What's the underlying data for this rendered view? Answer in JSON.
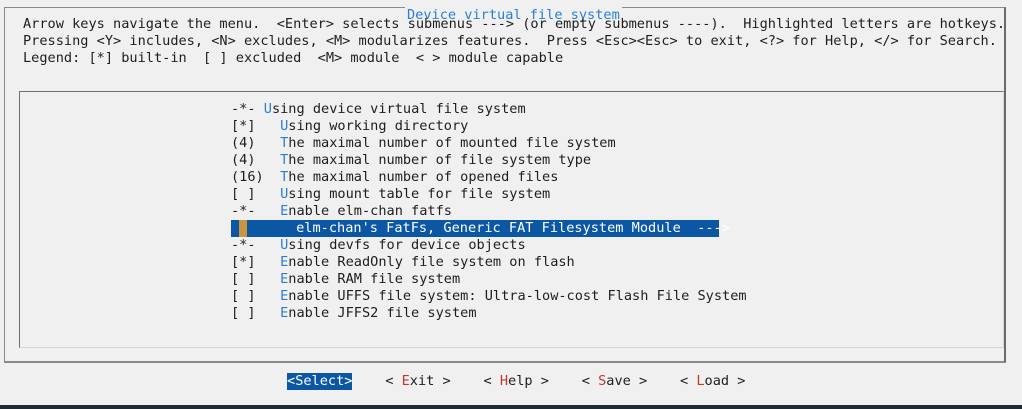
{
  "dialog": {
    "title": "Device virtual file system"
  },
  "help": {
    "line1": "Arrow keys navigate the menu.  <Enter> selects submenus ---> (or empty submenus ----).  Highlighted letters are hotkeys.",
    "line2": "Pressing <Y> includes, <N> excludes, <M> modularizes features.  Press <Esc><Esc> to exit, <?> for Help, </> for Search.",
    "line3": "Legend: [*] built-in  [ ] excluded  <M> module  < > module capable"
  },
  "menu": {
    "items": [
      {
        "prefix": "-*- ",
        "hot": "U",
        "rest": "sing device virtual file system"
      },
      {
        "prefix": "[*]   ",
        "hot": "U",
        "rest": "sing working directory"
      },
      {
        "prefix": "(4)   ",
        "hot": "T",
        "rest": "he maximal number of mounted file system"
      },
      {
        "prefix": "(4)   ",
        "hot": "T",
        "rest": "he maximal number of file system type"
      },
      {
        "prefix": "(16)  ",
        "hot": "T",
        "rest": "he maximal number of opened files"
      },
      {
        "prefix": "[ ]   ",
        "hot": "U",
        "rest": "sing mount table for file system"
      },
      {
        "prefix": "-*-   ",
        "hot": "E",
        "rest": "nable elm-chan fatfs"
      },
      {
        "prefix": "      ",
        "hot": "e",
        "rest": "lm-chan's FatFs, Generic FAT Filesystem Module  --->"
      },
      {
        "prefix": "-*-   ",
        "hot": "U",
        "rest": "sing devfs for device objects"
      },
      {
        "prefix": "[*]   ",
        "hot": "E",
        "rest": "nable ReadOnly file system on flash"
      },
      {
        "prefix": "[ ]   ",
        "hot": "E",
        "rest": "nable RAM file system"
      },
      {
        "prefix": "[ ]   ",
        "hot": "E",
        "rest": "nable UFFS file system: Ultra-low-cost Flash File System"
      },
      {
        "prefix": "[ ]   ",
        "hot": "E",
        "rest": "nable JFFS2 file system"
      }
    ]
  },
  "buttons": {
    "select": {
      "open": "<",
      "hot": "S",
      "rest": "elect",
      "close": ">"
    },
    "exit": {
      "open": "< ",
      "hot": "E",
      "rest": "xit",
      "close": " >"
    },
    "help": {
      "open": "< ",
      "hot": "H",
      "rest": "elp",
      "close": " >"
    },
    "save": {
      "open": "< ",
      "hot": "S",
      "rest": "ave",
      "close": " >"
    },
    "load": {
      "open": "< ",
      "hot": "L",
      "rest": "oad",
      "close": " >"
    }
  },
  "colors": {
    "accent": "#2a7fd4",
    "selection": "#0b57a4",
    "hotkey_button": "#c0392b",
    "background": "#f0f0f0"
  }
}
